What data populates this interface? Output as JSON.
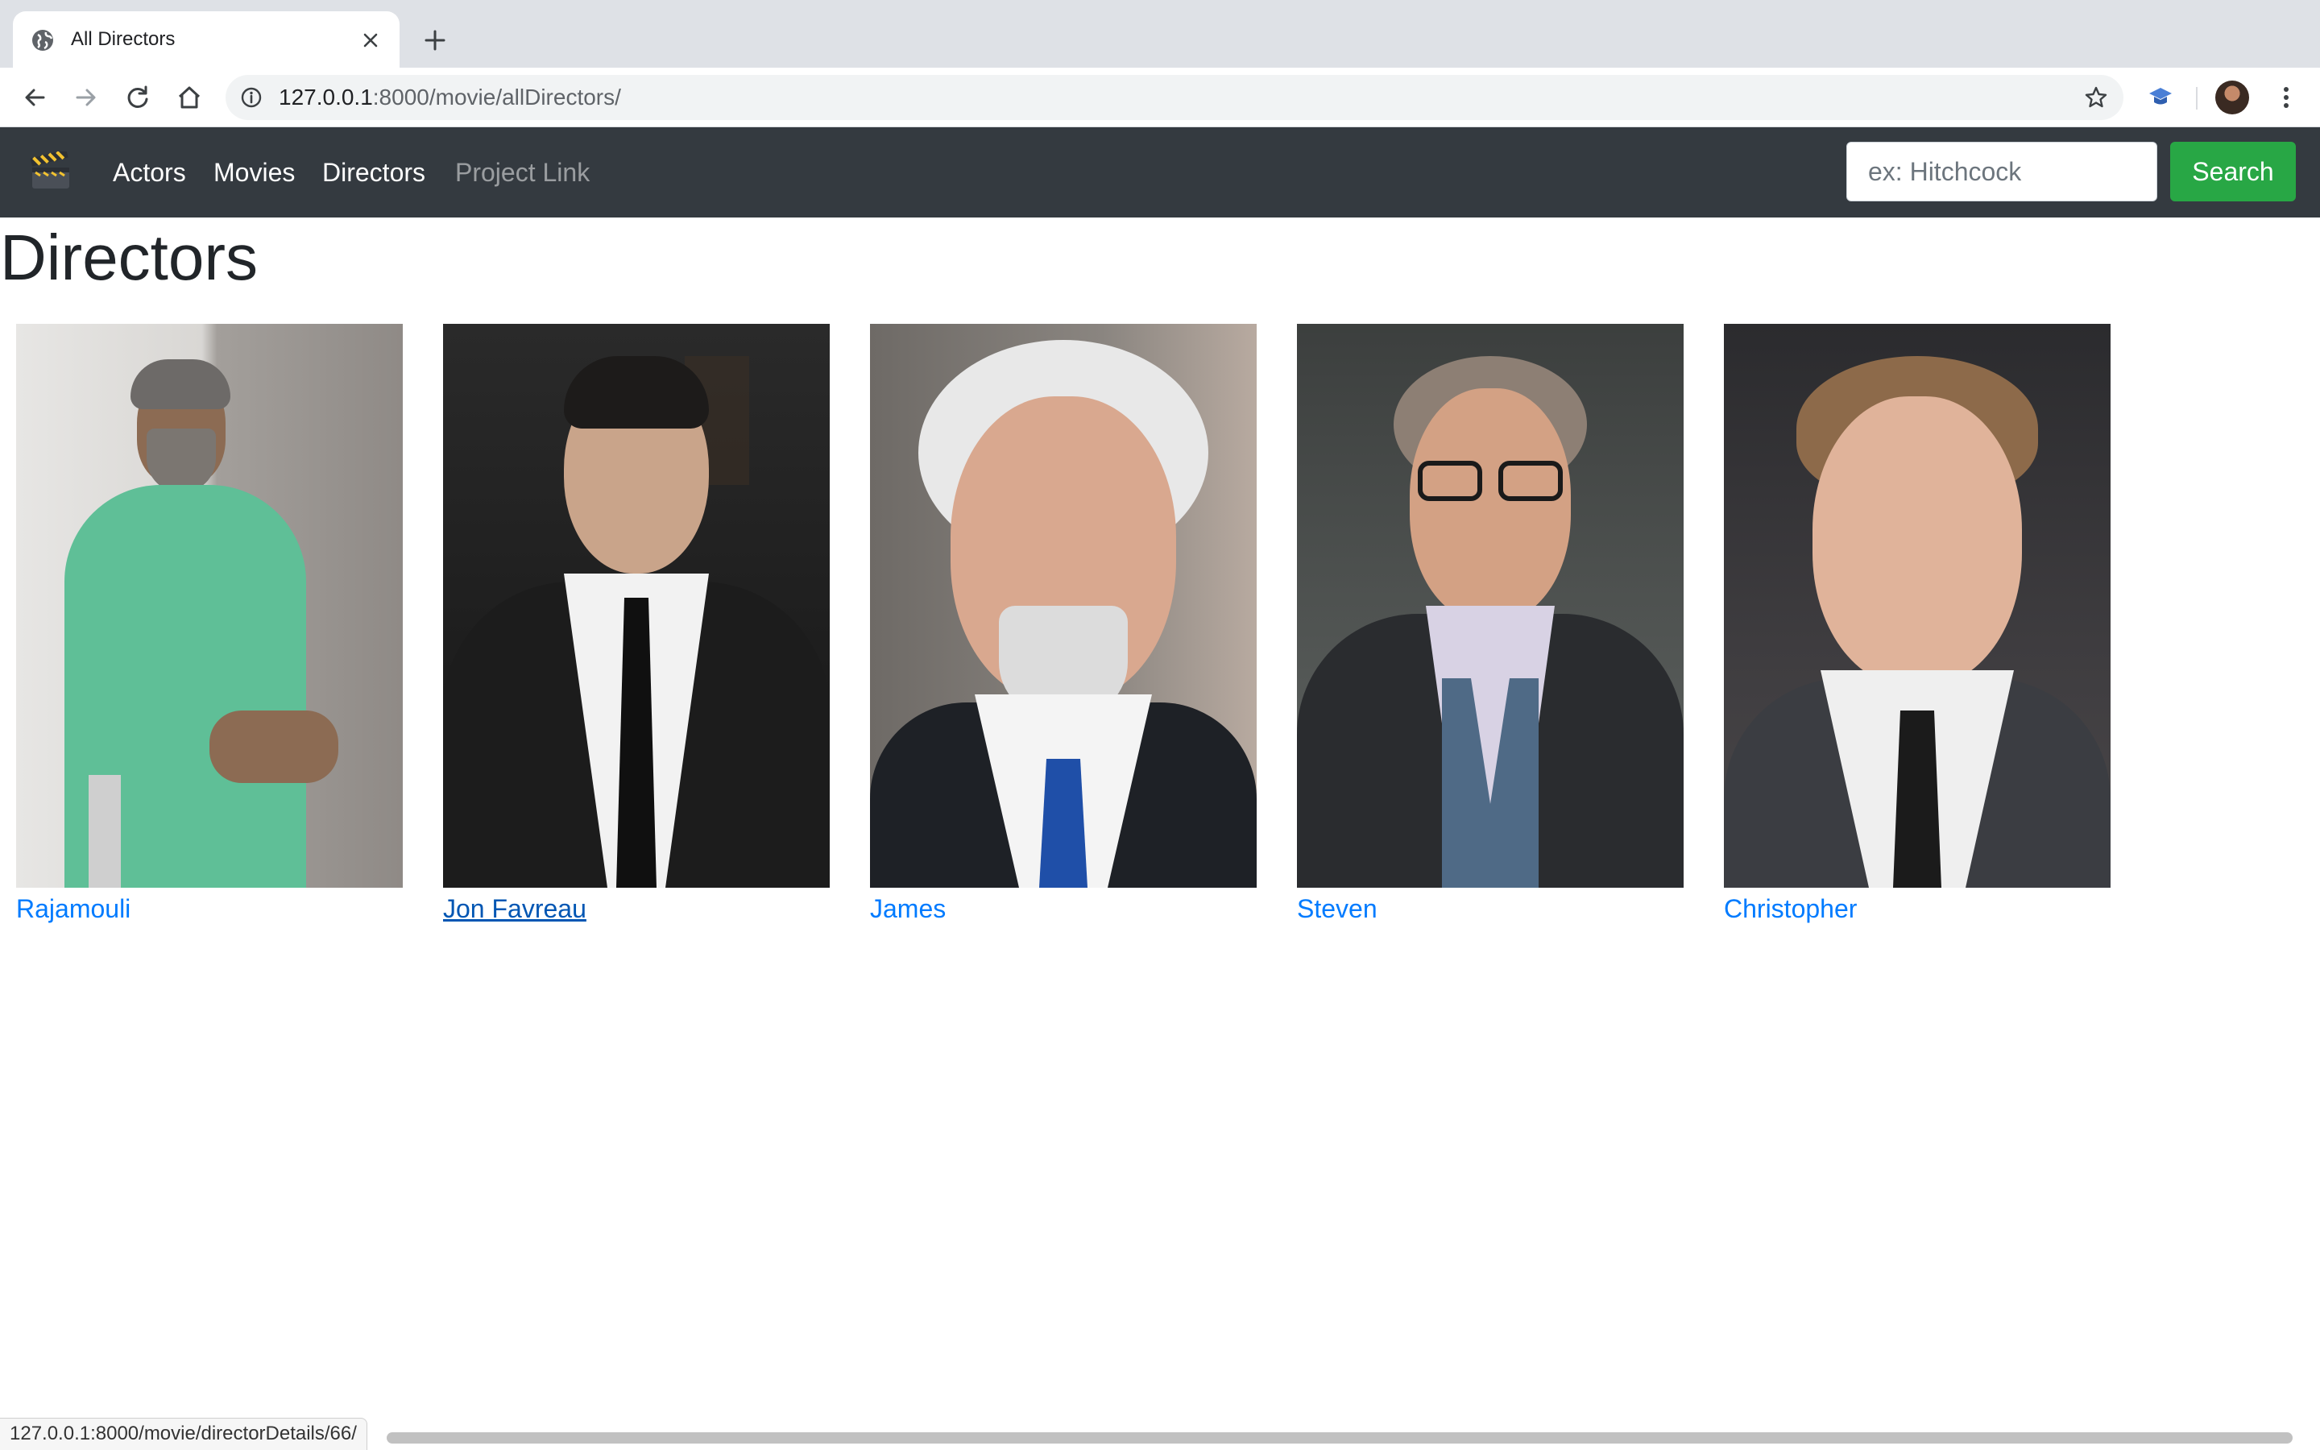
{
  "browser": {
    "tab_title": "All Directors",
    "url_host": "127.0.0.1",
    "url_rest": ":8000/movie/allDirectors/",
    "status_url": "127.0.0.1:8000/movie/directorDetails/66/"
  },
  "navbar": {
    "brand_icon": "clapperboard-icon",
    "links": [
      "Actors",
      "Movies",
      "Directors",
      "Project Link"
    ],
    "search_placeholder": "ex: Hitchcock",
    "search_button": "Search"
  },
  "page": {
    "title": "Directors"
  },
  "directors": [
    {
      "name": "Rajamouli",
      "photo": "portrait of man in green shirt"
    },
    {
      "name": "Jon Favreau",
      "photo": "portrait of man in black suit"
    },
    {
      "name": "James",
      "photo": "portrait of white-haired man in suit"
    },
    {
      "name": "Steven",
      "photo": "portrait of man with glasses"
    },
    {
      "name": "Christopher",
      "photo": "portrait of man in grey suit"
    }
  ],
  "colors": {
    "navbar_bg": "#343a40",
    "link": "#007bff",
    "search_button": "#28a745"
  }
}
